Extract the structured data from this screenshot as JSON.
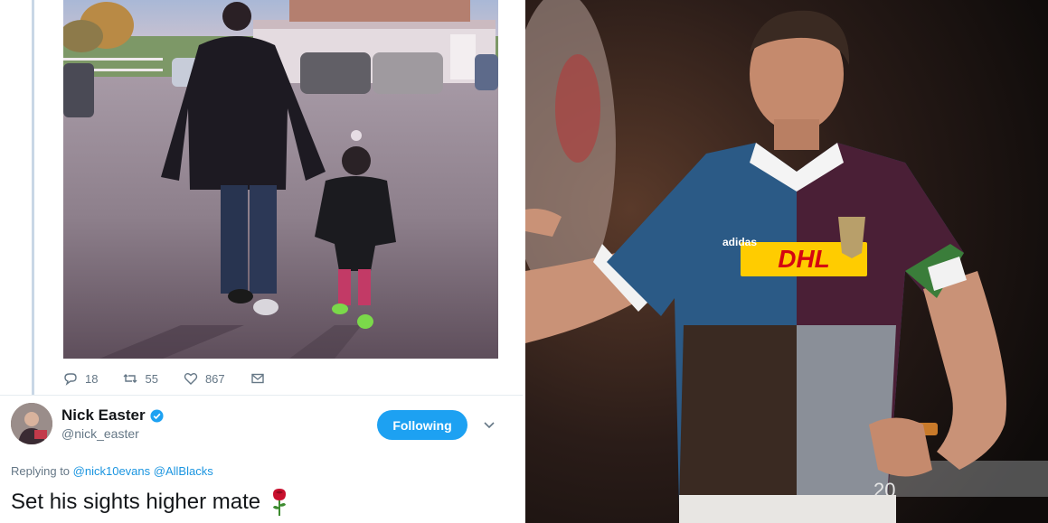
{
  "tweet_top": {
    "image_alt": "man-and-child-walking-photo",
    "actions": [
      {
        "icon": "reply-icon",
        "count": "18"
      },
      {
        "icon": "retweet-icon",
        "count": "55"
      },
      {
        "icon": "like-icon",
        "count": "867"
      },
      {
        "icon": "message-icon",
        "count": ""
      }
    ]
  },
  "reply": {
    "author_name": "Nick Easter",
    "author_handle": "@nick_easter",
    "follow_label": "Following",
    "replying_prefix": "Replying to",
    "mention1": "@nick10evans",
    "mention2": "@AllBlacks",
    "text": "Set his sights higher mate"
  },
  "right_photo": {
    "sponsor": "DHL",
    "kit_brand": "adidas",
    "number": "20"
  },
  "colors": {
    "twitter_blue": "#1da1f2",
    "mention_blue": "#1b95e0",
    "dhl_yellow": "#ffcc00",
    "dhl_red": "#d40511"
  }
}
